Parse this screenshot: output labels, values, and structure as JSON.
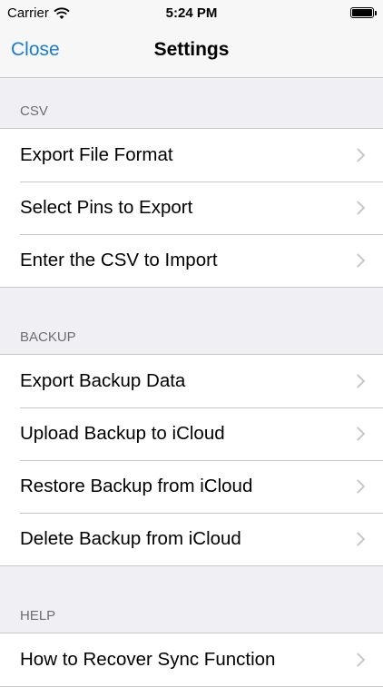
{
  "status": {
    "carrier": "Carrier",
    "time": "5:24 PM"
  },
  "nav": {
    "close": "Close",
    "title": "Settings"
  },
  "sections": {
    "csv": {
      "header": "CSV",
      "items": [
        "Export File Format",
        "Select Pins to Export",
        "Enter the CSV to Import"
      ]
    },
    "backup": {
      "header": "BACKUP",
      "items": [
        "Export Backup Data",
        "Upload Backup to iCloud",
        "Restore Backup from iCloud",
        "Delete Backup from iCloud"
      ]
    },
    "help": {
      "header": "HELP",
      "items": [
        "How to Recover Sync Function"
      ]
    }
  }
}
